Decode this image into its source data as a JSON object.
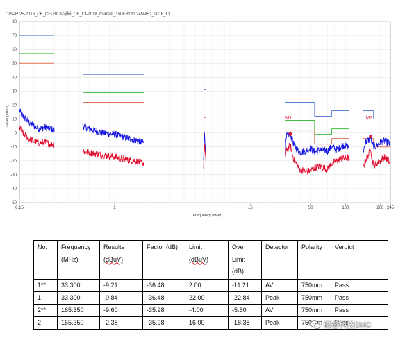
{
  "chart_data": {
    "type": "line",
    "title": "CISPR 25-2016_CE_CE-2018-汾磁_CE_L3-2018_Current_150KHz to 245MHz_2018_L3",
    "xlabel": "Frequency (MHz)",
    "ylabel": "Level (dBuV)",
    "xscale": "log",
    "xlim": [
      0.15,
      245
    ],
    "ylim": [
      -50,
      80
    ],
    "xticks": [
      0.15,
      1,
      15,
      50,
      100,
      200,
      245
    ],
    "xtick_labels": [
      "0.15",
      "1",
      "15",
      "50",
      "100",
      "200",
      "245"
    ],
    "yticks": [
      -50,
      -40,
      -30,
      -20,
      -10,
      0,
      10,
      20,
      30,
      40,
      50,
      60,
      70,
      80
    ],
    "grid": true,
    "colors": {
      "peak_limit": "#5b7fd6",
      "qp_limit": "#3fbf3f",
      "avg_limit": "#e07050",
      "peak_trace": "#1414e0",
      "avg_trace": "#e01030"
    },
    "limit_lines": [
      {
        "kind": "peak",
        "segments": [
          [
            0.15,
            0.3,
            70
          ],
          [
            0.53,
            1.8,
            42
          ],
          [
            5.9,
            6.2,
            31
          ],
          [
            30,
            54,
            22
          ],
          [
            54,
            76,
            12
          ],
          [
            76,
            108,
            16
          ],
          [
            142,
            175,
            16
          ],
          [
            175,
            245,
            10
          ]
        ]
      },
      {
        "kind": "qp",
        "segments": [
          [
            0.15,
            0.3,
            57
          ],
          [
            0.53,
            1.8,
            29
          ],
          [
            5.9,
            6.2,
            18
          ],
          [
            30,
            54,
            9
          ],
          [
            54,
            76,
            -1
          ],
          [
            76,
            108,
            3
          ]
        ]
      },
      {
        "kind": "avg",
        "segments": [
          [
            0.15,
            0.3,
            50
          ],
          [
            0.53,
            1.8,
            22
          ],
          [
            5.9,
            6.2,
            11
          ],
          [
            30,
            54,
            2
          ],
          [
            54,
            76,
            -8
          ],
          [
            76,
            108,
            -4
          ],
          [
            142,
            175,
            -4
          ],
          [
            175,
            245,
            -10
          ]
        ]
      }
    ],
    "traces": [
      {
        "kind": "peak",
        "segments": [
          {
            "x": [
              0.15,
              0.16,
              0.18,
              0.2,
              0.22,
              0.25,
              0.28,
              0.3
            ],
            "y": [
              16,
              12,
              8,
              5,
              3,
              4,
              3,
              2
            ]
          },
          {
            "x": [
              0.53,
              0.6,
              0.7,
              0.8,
              1.0,
              1.2,
              1.5,
              1.8
            ],
            "y": [
              5,
              3,
              1,
              0,
              -1,
              -3,
              -5,
              -7
            ]
          },
          {
            "x": [
              5.9,
              6.0,
              6.1,
              6.2
            ],
            "y": [
              -20,
              2,
              -10,
              -18
            ]
          },
          {
            "x": [
              30,
              31,
              33.3,
              36,
              40,
              45,
              50,
              54,
              60,
              70,
              76,
              85,
              95,
              108
            ],
            "y": [
              -12,
              -2,
              -0.84,
              -9,
              -14,
              -13,
              -11,
              -14,
              -12,
              -13,
              -10,
              -12,
              -9,
              -10
            ]
          },
          {
            "x": [
              142,
              150,
              160,
              165.35,
              170,
              180,
              200,
              220,
              245
            ],
            "y": [
              -14,
              -6,
              -5,
              -2.38,
              -8,
              -10,
              -7,
              -6,
              -8
            ]
          }
        ]
      },
      {
        "kind": "avg",
        "segments": [
          {
            "x": [
              0.15,
              0.16,
              0.18,
              0.2,
              0.22,
              0.25,
              0.28,
              0.3
            ],
            "y": [
              4,
              0,
              -4,
              -6,
              -7,
              -7,
              -8,
              -8
            ]
          },
          {
            "x": [
              0.53,
              0.6,
              0.7,
              0.8,
              1.0,
              1.2,
              1.5,
              1.8
            ],
            "y": [
              -13,
              -14,
              -15,
              -16,
              -17,
              -19,
              -20,
              -22
            ]
          },
          {
            "x": [
              5.9,
              6.0,
              6.1,
              6.2
            ],
            "y": [
              -25,
              -7,
              -15,
              -22
            ]
          },
          {
            "x": [
              30,
              31,
              33.3,
              36,
              40,
              45,
              50,
              54,
              60,
              70,
              76,
              85,
              95,
              108
            ],
            "y": [
              -18,
              -12,
              -9.21,
              -20,
              -26,
              -28,
              -27,
              -25,
              -24,
              -26,
              -22,
              -20,
              -18,
              -18
            ]
          },
          {
            "x": [
              142,
              150,
              160,
              165.35,
              170,
              180,
              200,
              220,
              245
            ],
            "y": [
              -25,
              -19,
              -15,
              -9.6,
              -20,
              -23,
              -20,
              -17,
              -22
            ]
          }
        ]
      }
    ],
    "markers": [
      {
        "label": "M1",
        "x": 33.3,
        "y": -0.84
      },
      {
        "label": "M2",
        "x": 165.35,
        "y": -2.38
      }
    ]
  },
  "table": {
    "headers": [
      [
        "No."
      ],
      [
        "Frequency",
        "(MHz)"
      ],
      [
        "Results",
        "(dBuV)"
      ],
      [
        "Factor (dB)"
      ],
      [
        "Limit",
        "(dBuV)"
      ],
      [
        "Over",
        "Limit",
        "(dB)"
      ],
      [
        "Detector"
      ],
      [
        "Polarity"
      ],
      [
        "Verdict"
      ]
    ],
    "rows": [
      [
        "1**",
        "33.300",
        "-9.21",
        "-36.48",
        "2.00",
        "-11.21",
        "AV",
        "750mm",
        "Pass"
      ],
      [
        "1",
        "33.300",
        "-0.84",
        "-36.48",
        "22.00",
        "-22.84",
        "Peak",
        "750mm",
        "Pass"
      ],
      [
        "2**",
        "165.350",
        "-9.60",
        "-35.98",
        "-4.00",
        "-5.60",
        "AV",
        "750mm",
        "Pass"
      ],
      [
        "2",
        "165.350",
        "-2.38",
        "-35.98",
        "16.00",
        "-18.38",
        "Peak",
        "750mm",
        "Pass"
      ]
    ]
  },
  "watermark": {
    "text": "磁睿科技EMC",
    "icon": "wechat-icon"
  }
}
